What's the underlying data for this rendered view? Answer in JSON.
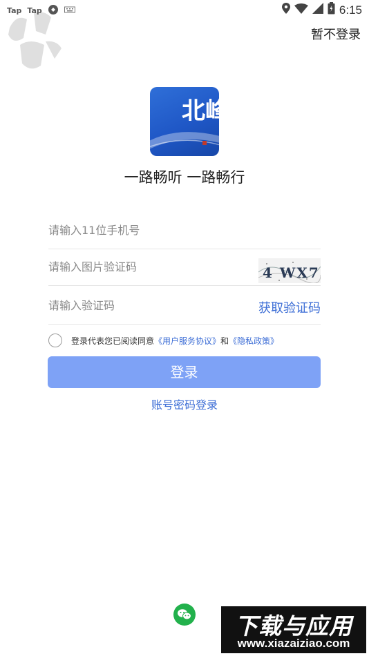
{
  "status_bar": {
    "left_labels": [
      "Tap",
      "Tap"
    ],
    "time": "6:15"
  },
  "header": {
    "skip_label": "暂不登录"
  },
  "app": {
    "logo_text": "北峰",
    "slogan": "一路畅听 一路畅行"
  },
  "form": {
    "phone_placeholder": "请输入11位手机号",
    "captcha_placeholder": "请输入图片验证码",
    "captcha_text": "4 WX7",
    "sms_placeholder": "请输入验证码",
    "get_code_label": "获取验证码",
    "agreement": {
      "prefix": "登录代表您已阅读同意",
      "link1": "《用户服务协议》",
      "middle": "和",
      "link2": "《隐私政策》"
    },
    "login_label": "登录",
    "password_login_label": "账号密码登录"
  },
  "watermark": {
    "big_text": "下载与应用",
    "url": "www.xiazaiziao.com"
  },
  "colors": {
    "accent": "#3d6ed6",
    "login_button": "#7ea2f6",
    "logo_blue": "#2060cc",
    "wechat_green": "#22b14c"
  }
}
